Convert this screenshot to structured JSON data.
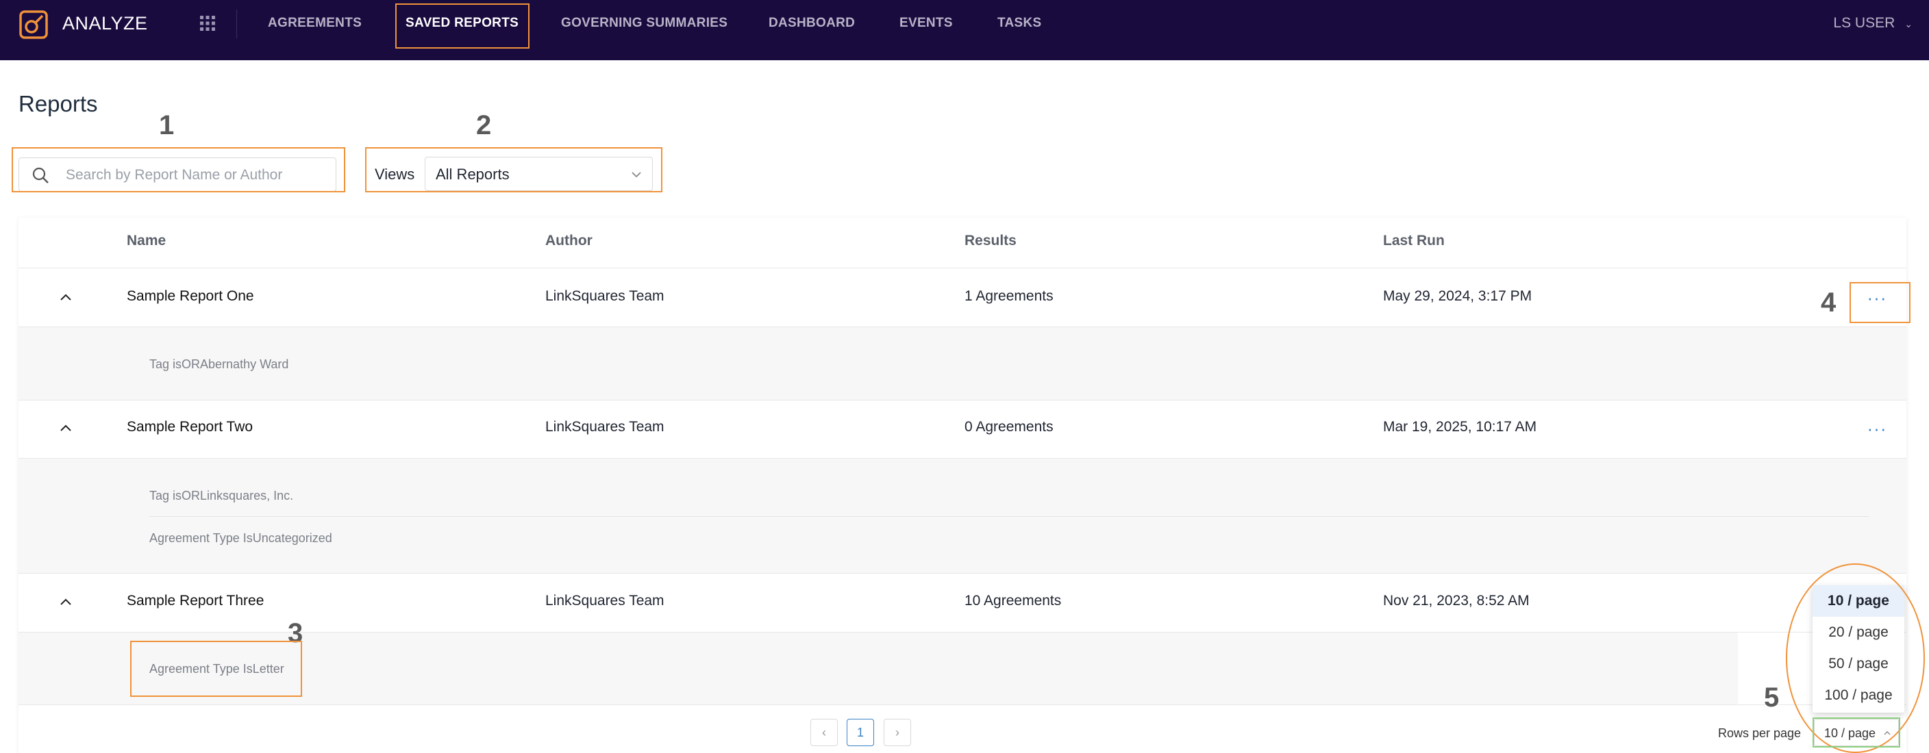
{
  "app": {
    "title": "ANALYZE"
  },
  "nav": {
    "items": [
      {
        "label": "AGREEMENTS"
      },
      {
        "label": "SAVED REPORTS"
      },
      {
        "label": "GOVERNING SUMMARIES"
      },
      {
        "label": "DASHBOARD"
      },
      {
        "label": "EVENTS"
      },
      {
        "label": "TASKS"
      }
    ],
    "active_index": 1,
    "user_label": "LS USER"
  },
  "page": {
    "title": "Reports"
  },
  "search": {
    "placeholder": "Search by Report Name or Author",
    "value": ""
  },
  "views": {
    "label": "Views",
    "selected": "All Reports"
  },
  "table": {
    "columns": [
      "Name",
      "Author",
      "Results",
      "Last Run"
    ],
    "rows": [
      {
        "name": "Sample Report One",
        "author": "LinkSquares Team",
        "results": "1 Agreements",
        "last_run": "May 29, 2024, 3:17 PM",
        "filters": [
          "Tag isORAbernathy Ward"
        ]
      },
      {
        "name": "Sample Report Two",
        "author": "LinkSquares Team",
        "results": "0 Agreements",
        "last_run": "Mar 19, 2025, 10:17 AM",
        "filters": [
          "Tag isORLinksquares, Inc.",
          "Agreement Type IsUncategorized"
        ]
      },
      {
        "name": "Sample Report Three",
        "author": "LinkSquares Team",
        "results": "10 Agreements",
        "last_run": "Nov 21, 2023, 8:52 AM",
        "filters": [
          "Agreement Type IsLetter"
        ]
      }
    ]
  },
  "pagination": {
    "current_page": "1",
    "rows_per_page_label": "Rows per page",
    "rows_per_page": "10 / page",
    "options": [
      "10 / page",
      "20 / page",
      "50 / page",
      "100 / page"
    ]
  },
  "annotations": [
    "1",
    "2",
    "3",
    "4",
    "5"
  ],
  "colors": {
    "nav_bg": "#1a0b3f",
    "accent": "#3b82c4",
    "logo": "#f0923a",
    "annotation": "#f0923a"
  }
}
